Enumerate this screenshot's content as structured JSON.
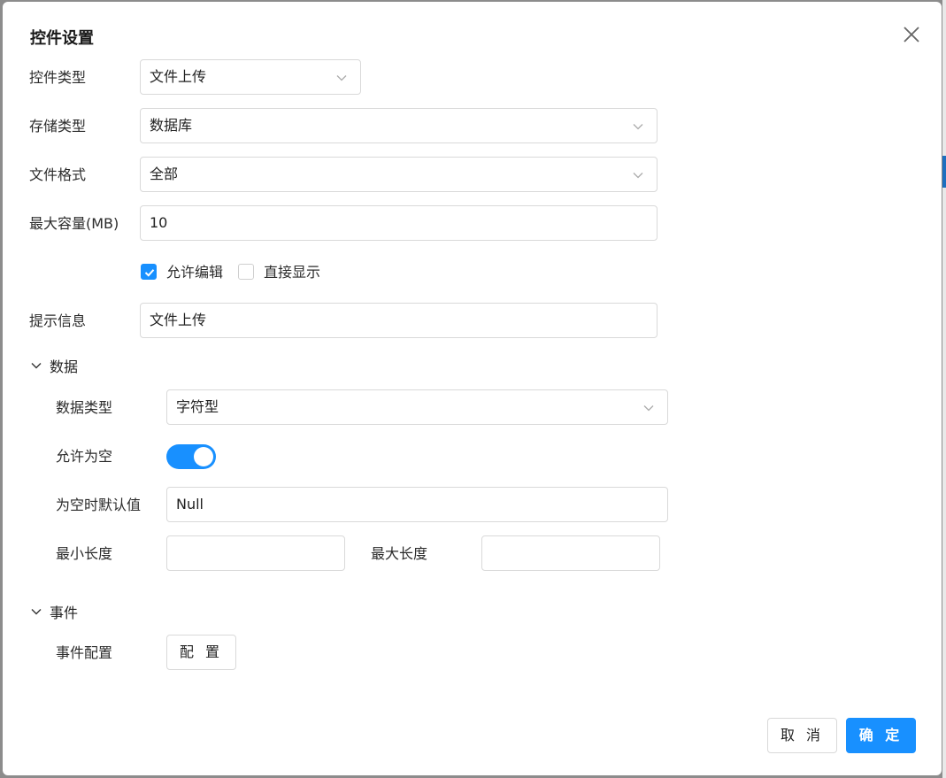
{
  "dialog": {
    "title": "控件设置",
    "close_icon": "close-icon"
  },
  "form": {
    "control_type": {
      "label": "控件类型",
      "value": "文件上传"
    },
    "storage_type": {
      "label": "存储类型",
      "value": "数据库"
    },
    "file_format": {
      "label": "文件格式",
      "value": "全部"
    },
    "max_size": {
      "label": "最大容量(MB)",
      "value": "10"
    },
    "allow_edit": {
      "label": "允许编辑",
      "checked": true
    },
    "direct_display": {
      "label": "直接显示",
      "checked": false
    },
    "hint": {
      "label": "提示信息",
      "value": "文件上传"
    }
  },
  "data_section": {
    "title": "数据",
    "expanded": true,
    "data_type": {
      "label": "数据类型",
      "value": "字符型"
    },
    "allow_null": {
      "label": "允许为空",
      "on": true
    },
    "null_default": {
      "label": "为空时默认值",
      "value": "Null"
    },
    "min_length": {
      "label": "最小长度",
      "value": ""
    },
    "max_length": {
      "label": "最大长度",
      "value": ""
    }
  },
  "event_section": {
    "title": "事件",
    "expanded": true,
    "event_config": {
      "label": "事件配置",
      "button": "配 置"
    }
  },
  "footer": {
    "cancel": "取 消",
    "ok": "确 定"
  },
  "colors": {
    "primary": "#1890ff",
    "border": "#d9d9d9"
  }
}
